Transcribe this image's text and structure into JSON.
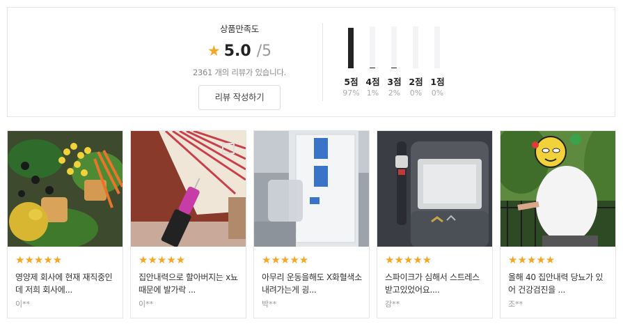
{
  "summary": {
    "title": "상품만족도",
    "score": "5.0",
    "max": "/5",
    "review_count": "2361 개의 리뷰가 있습니다.",
    "write_button": "리뷰 작성하기",
    "distribution": [
      {
        "label": "5점",
        "pct_text": "97%",
        "pct": 97
      },
      {
        "label": "4점",
        "pct_text": "1%",
        "pct": 1
      },
      {
        "label": "3점",
        "pct_text": "2%",
        "pct": 2
      },
      {
        "label": "2점",
        "pct_text": "0%",
        "pct": 0
      },
      {
        "label": "1점",
        "pct_text": "0%",
        "pct": 0
      }
    ]
  },
  "reviews": [
    {
      "stars": "★★★★★",
      "rating": 5,
      "text": "영양제 회사에 현재 재직중인데 저희 회사에...",
      "author": "이**"
    },
    {
      "stars": "★★★★★",
      "rating": 5,
      "text": "집안내력으로 할아버지는 x뇨때문에 발가락 ...",
      "author": "이**"
    },
    {
      "stars": "★★★★★",
      "rating": 5,
      "text": "아무리 운동을해도 X화혈색소 내려가는게 굉...",
      "author": "박**"
    },
    {
      "stars": "★★★★★",
      "rating": 5,
      "text": "스파이크가 심해서 스트레스 받고있었어요....",
      "author": "강**"
    },
    {
      "stars": "★★★★★",
      "rating": 5,
      "text": "올해 40 집안내력 당뇨가 있어 건강검진을 ...",
      "author": "조**"
    }
  ],
  "colors": {
    "star": "#f5a623",
    "bar": "#222222",
    "track": "#f4f4f6"
  }
}
